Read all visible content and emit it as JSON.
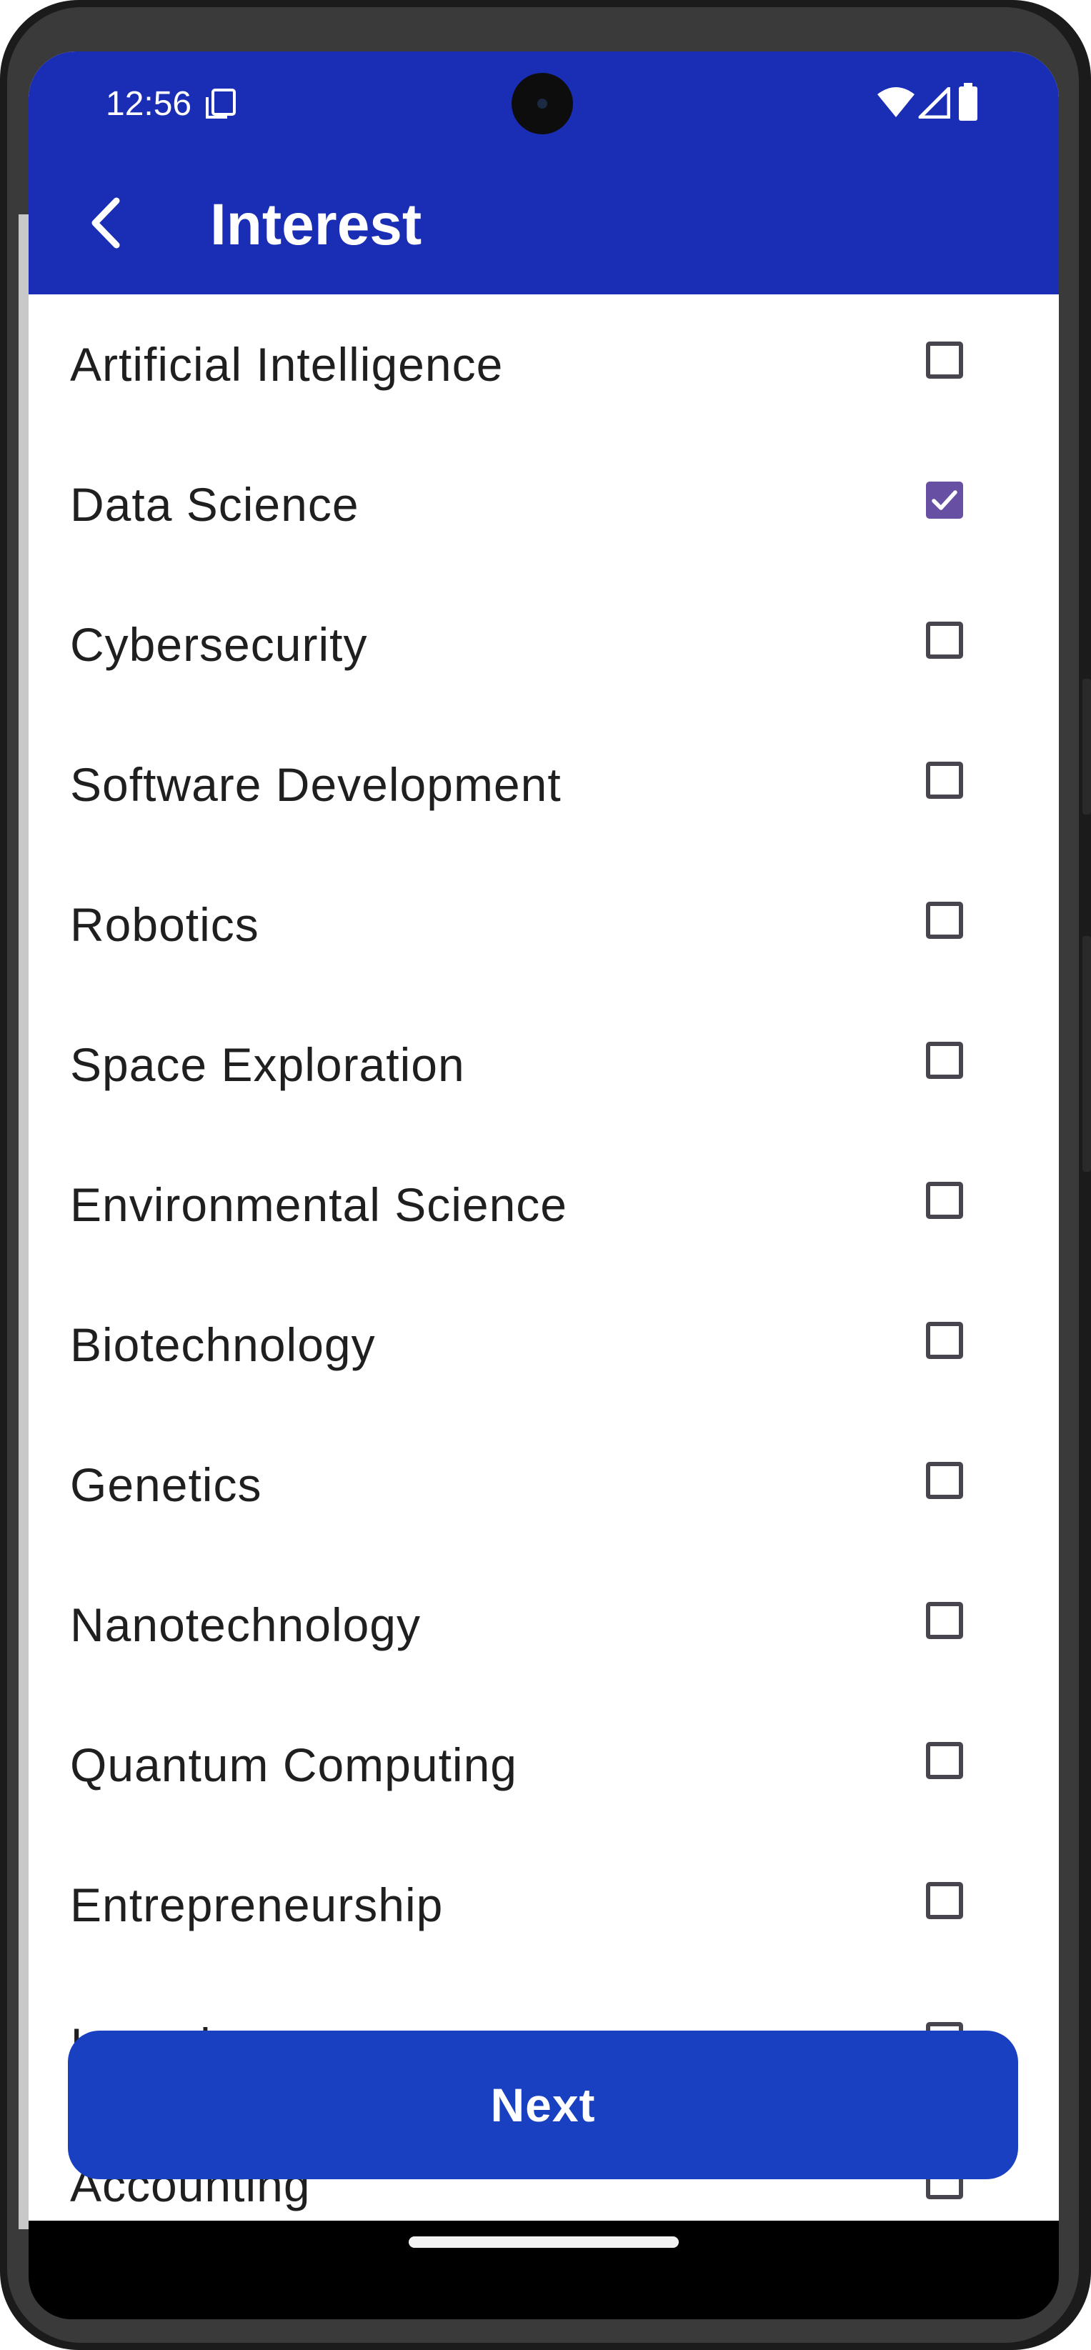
{
  "status_bar": {
    "time": "12:56"
  },
  "app_bar": {
    "title": "Interest"
  },
  "interests": [
    {
      "label": "Artificial Intelligence",
      "checked": false
    },
    {
      "label": "Data Science",
      "checked": true
    },
    {
      "label": "Cybersecurity",
      "checked": false
    },
    {
      "label": "Software Development",
      "checked": false
    },
    {
      "label": "Robotics",
      "checked": false
    },
    {
      "label": "Space Exploration",
      "checked": false
    },
    {
      "label": "Environmental Science",
      "checked": false
    },
    {
      "label": "Biotechnology",
      "checked": false
    },
    {
      "label": "Genetics",
      "checked": false
    },
    {
      "label": "Nanotechnology",
      "checked": false
    },
    {
      "label": "Quantum Computing",
      "checked": false
    },
    {
      "label": "Entrepreneurship",
      "checked": false
    },
    {
      "label": "Investing",
      "checked": false
    },
    {
      "label": "Accounting",
      "checked": false
    }
  ],
  "next_button": {
    "label": "Next"
  },
  "colors": {
    "app_bar": "#1a2db5",
    "button": "#1a40c2",
    "checkbox_checked": "#6750a4"
  }
}
